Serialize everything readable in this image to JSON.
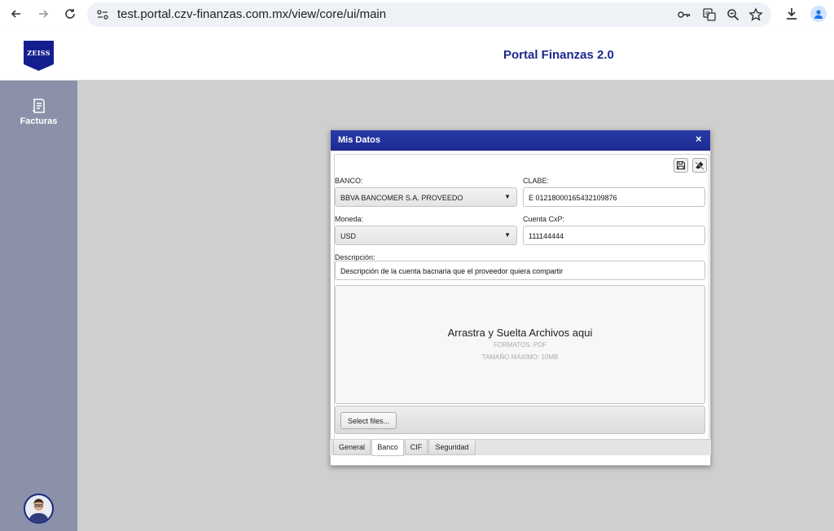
{
  "browser": {
    "url": "test.portal.czv-finanzas.com.mx/view/core/ui/main"
  },
  "header": {
    "logo_text": "ZEISS",
    "title": "Portal Finanzas 2.0"
  },
  "sidebar": {
    "items": [
      {
        "label": "Facturas",
        "icon": "receipt-icon"
      }
    ]
  },
  "dialog": {
    "title": "Mis Datos",
    "close_glyph": "×",
    "fields": {
      "banco_label": "BANCO:",
      "banco_value": "BBVA BANCOMER S.A. PROVEEDO",
      "clabe_label": "CLABE:",
      "clabe_value": "E 01218000165432109876",
      "moneda_label": "Moneda:",
      "moneda_value": "USD",
      "cuenta_label": "Cuenta CxP:",
      "cuenta_value": "111144444",
      "descripcion_label": "Descripción:",
      "descripcion_value": "Descripción de la cuenta bacnaria que el proveedor quiera compartir"
    },
    "dropzone": {
      "title": "Arrastra y Suelta Archivos aqui",
      "formats": "FORMATOS: PDF",
      "max_size": "TAMAÑO MÁXIMO: 10MB"
    },
    "select_files_label": "Select files...",
    "tabs": [
      {
        "label": "General"
      },
      {
        "label": "Banco",
        "active": true
      },
      {
        "label": "CIF"
      },
      {
        "label": "Seguridad"
      }
    ]
  },
  "colors": {
    "brand": "#1b2a8f",
    "sidebar": "#8b91a8",
    "content_bg": "#cfcfcf"
  }
}
